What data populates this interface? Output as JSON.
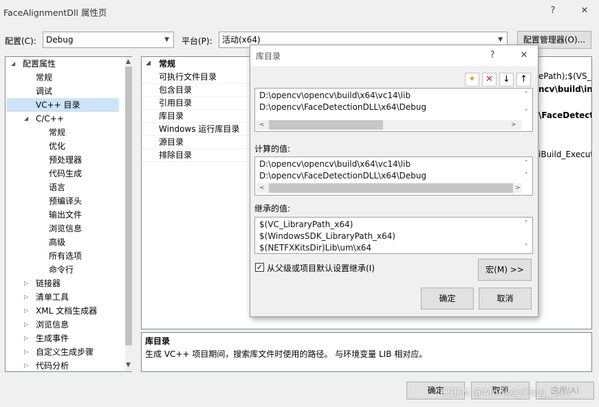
{
  "window": {
    "title": "FaceAlignmentDll 属性页",
    "help": "?",
    "close": "✕"
  },
  "config": {
    "label": "配置(C):",
    "value": "Debug",
    "platform_label": "平台(P):",
    "platform_value": "活动(x64)",
    "manager_button": "配置管理器(O)..."
  },
  "tree": {
    "items": [
      {
        "label": "配置属性",
        "toggle": "◢"
      },
      {
        "label": "常规"
      },
      {
        "label": "调试"
      },
      {
        "label": "VC++ 目录"
      },
      {
        "label": "C/C++",
        "toggle": "◢"
      },
      {
        "label": "常规"
      },
      {
        "label": "优化"
      },
      {
        "label": "预处理器"
      },
      {
        "label": "代码生成"
      },
      {
        "label": "语言"
      },
      {
        "label": "预编译头"
      },
      {
        "label": "输出文件"
      },
      {
        "label": "浏览信息"
      },
      {
        "label": "高级"
      },
      {
        "label": "所有选项"
      },
      {
        "label": "命令行"
      },
      {
        "label": "链接器",
        "toggle": "▷"
      },
      {
        "label": "清单工具",
        "toggle": "▷"
      },
      {
        "label": "XML 文档生成器",
        "toggle": "▷"
      },
      {
        "label": "浏览信息",
        "toggle": "▷"
      },
      {
        "label": "生成事件",
        "toggle": "▷"
      },
      {
        "label": "自定义生成步骤",
        "toggle": "▷"
      },
      {
        "label": "代码分析",
        "toggle": "▷"
      }
    ]
  },
  "grid": {
    "section": "常规",
    "rows": [
      "可执行文件目录",
      "包含目录",
      "引用目录",
      "库目录",
      "Windows 运行库目录",
      "源目录",
      "排除目录"
    ],
    "values": [
      "ePath);$(VS_E",
      "ncv\\build\\inc",
      "\\FaceDetectio",
      "iBuild_Executa"
    ]
  },
  "description": {
    "title": "库目录",
    "text": "生成 VC++ 项目期间，搜索库文件时使用的路径。 与环境变量 LIB 相对应。"
  },
  "dialog": {
    "title": "库目录",
    "help": "?",
    "close": "✕",
    "toolbar": {
      "new": "✦",
      "delete": "✕",
      "down": "↓",
      "up": "↑"
    },
    "paths": [
      "D:\\opencv\\opencv\\build\\x64\\vc14\\lib",
      "D:\\opencv\\FaceDetectionDLL\\x64\\Debug"
    ],
    "computed_label": "计算的值:",
    "computed": [
      "D:\\opencv\\opencv\\build\\x64\\vc14\\lib",
      "D:\\opencv\\FaceDetectionDLL\\x64\\Debug"
    ],
    "inherited_label": "继承的值:",
    "inherited": [
      "$(VC_LibraryPath_x64)",
      "$(WindowsSDK_LibraryPath_x64)",
      "$(NETFXKitsDir)Lib\\um\\x64"
    ],
    "inherit_checkbox": "从父级或项目默认设置继承(I)",
    "inherit_checked": true,
    "macros_button": "宏(M) >>",
    "ok": "确定",
    "cancel": "取消"
  },
  "footer": {
    "ok": "确定",
    "cancel": "取消",
    "apply": "应用(A)",
    "watermark": "CSDN @MonkeyKing_Sun"
  },
  "colors": {
    "selection": "#cce4f7",
    "delete_red": "#c42b1c"
  }
}
